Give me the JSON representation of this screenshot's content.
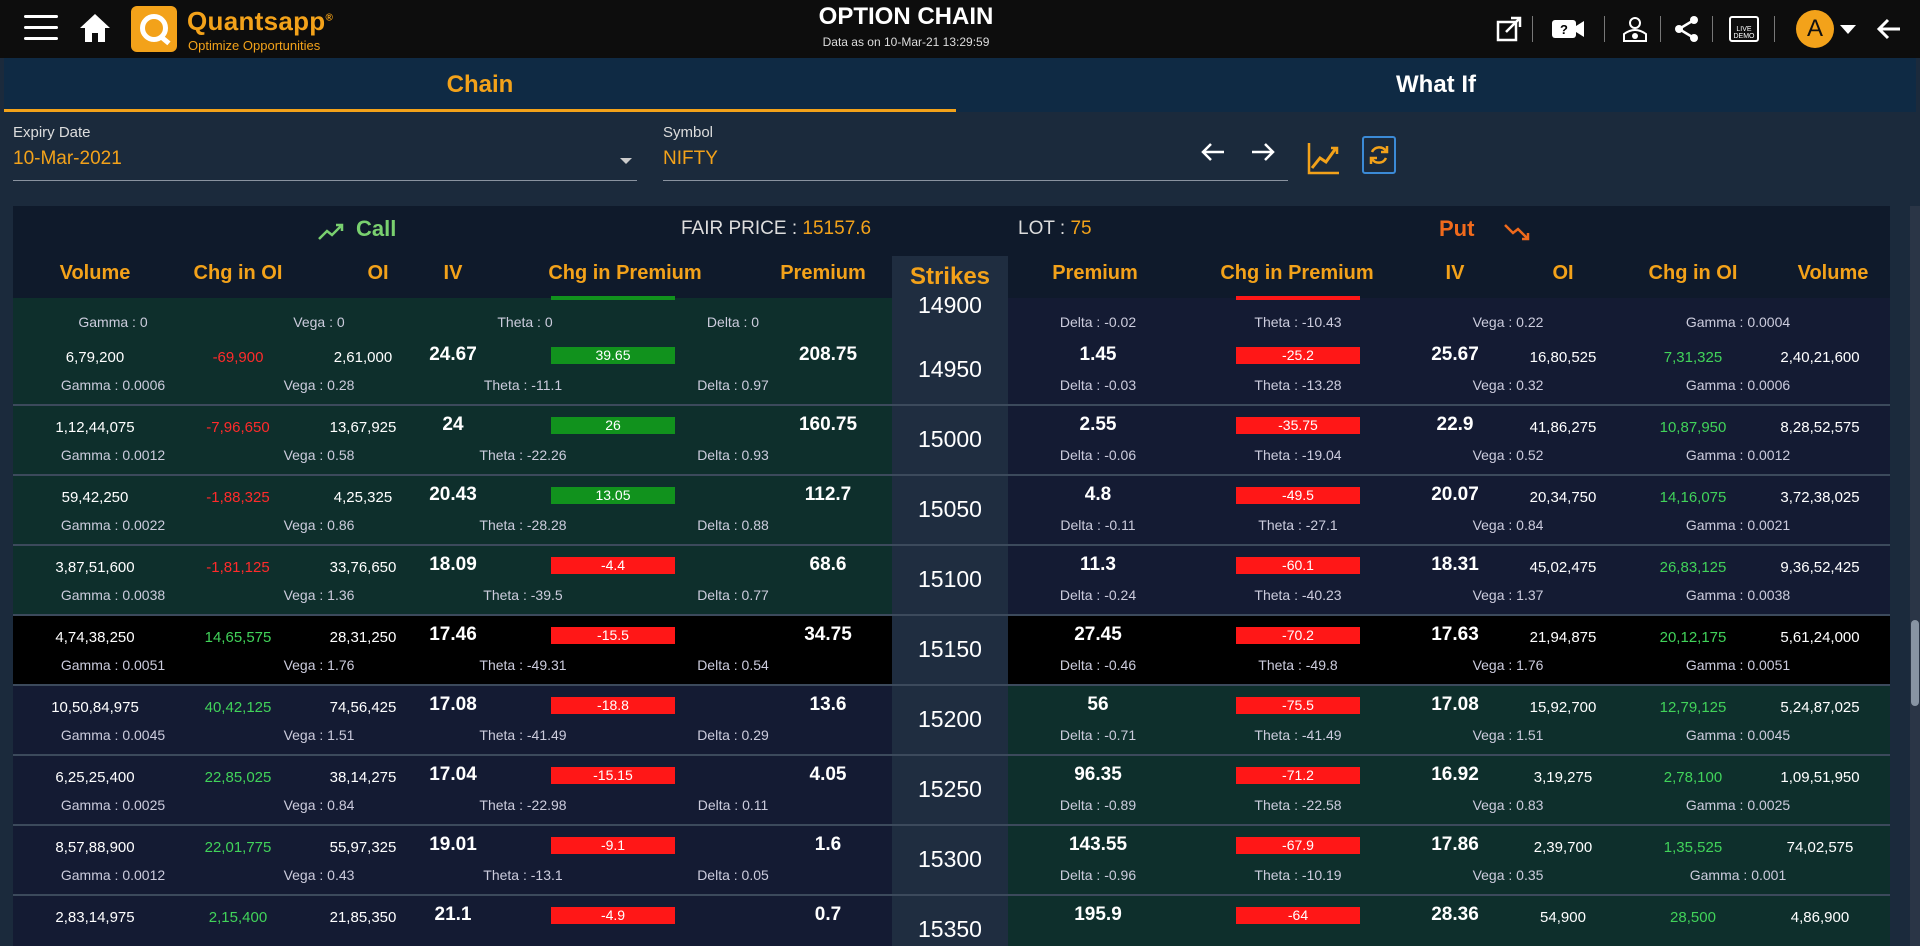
{
  "header": {
    "brand": "Quantsapp",
    "trademark": "®",
    "tagline": "Optimize Opportunities",
    "title": "OPTION CHAIN",
    "subtitle": "Data as on 10-Mar-21 13:29:59",
    "avatar_initial": "A",
    "icons": [
      "menu-icon",
      "home-icon",
      "popout-icon",
      "video-icon",
      "users-icon",
      "share-icon",
      "live-demo-icon",
      "back-arrow-icon"
    ]
  },
  "tabs": [
    {
      "label": "Chain",
      "active": true
    },
    {
      "label": "What If",
      "active": false
    }
  ],
  "filters": {
    "expiry_label": "Expiry Date",
    "expiry_value": "10-Mar-2021",
    "symbol_label": "Symbol",
    "symbol_value": "NIFTY"
  },
  "summary": {
    "call_label": "Call",
    "put_label": "Put",
    "fair_price_label": "FAIR PRICE :",
    "fair_price_value": "15157.6",
    "lot_label": "LOT :",
    "lot_value": "75"
  },
  "columns": {
    "call": [
      "Volume",
      "Chg in OI",
      "OI",
      "IV",
      "Chg in Premium",
      "Premium"
    ],
    "strikes": "Strikes",
    "put": [
      "Premium",
      "Chg in Premium",
      "IV",
      "OI",
      "Chg in OI",
      "Volume"
    ]
  },
  "partial_row": {
    "strike": "14900",
    "call_gamma": "Gamma : 0",
    "call_vega": "Vega : 0",
    "call_theta": "Theta : 0",
    "call_delta": "Delta : 0",
    "put_delta": "Delta : -0.02",
    "put_theta": "Theta : -10.43",
    "put_vega": "Vega : 0.22",
    "put_gamma": "Gamma : 0.0004"
  },
  "rows": [
    {
      "strike": "14950",
      "c_vol": "6,79,200",
      "c_chgoi": "-69,900",
      "c_oi": "2,61,000",
      "c_iv": "24.67",
      "c_chgprem": "39.65",
      "c_prem": "208.75",
      "c_gamma": "Gamma : 0.0006",
      "c_vega": "Vega : 0.28",
      "c_theta": "Theta : -11.1",
      "c_delta": "Delta : 0.97",
      "p_prem": "1.45",
      "p_chgprem": "-25.2",
      "p_iv": "25.67",
      "p_oi": "16,80,525",
      "p_chgoi": "7,31,325",
      "p_vol": "2,40,21,600",
      "p_delta": "Delta : -0.03",
      "p_theta": "Theta : -13.28",
      "p_vega": "Vega : 0.32",
      "p_gamma": "Gamma : 0.0006"
    },
    {
      "strike": "15000",
      "c_vol": "1,12,44,075",
      "c_chgoi": "-7,96,650",
      "c_oi": "13,67,925",
      "c_iv": "24",
      "c_chgprem": "26",
      "c_prem": "160.75",
      "c_gamma": "Gamma : 0.0012",
      "c_vega": "Vega : 0.58",
      "c_theta": "Theta : -22.26",
      "c_delta": "Delta : 0.93",
      "p_prem": "2.55",
      "p_chgprem": "-35.75",
      "p_iv": "22.9",
      "p_oi": "41,86,275",
      "p_chgoi": "10,87,950",
      "p_vol": "8,28,52,575",
      "p_delta": "Delta : -0.06",
      "p_theta": "Theta : -19.04",
      "p_vega": "Vega : 0.52",
      "p_gamma": "Gamma : 0.0012"
    },
    {
      "strike": "15050",
      "c_vol": "59,42,250",
      "c_chgoi": "-1,88,325",
      "c_oi": "4,25,325",
      "c_iv": "20.43",
      "c_chgprem": "13.05",
      "c_prem": "112.7",
      "c_gamma": "Gamma : 0.0022",
      "c_vega": "Vega : 0.86",
      "c_theta": "Theta : -28.28",
      "c_delta": "Delta : 0.88",
      "p_prem": "4.8",
      "p_chgprem": "-49.5",
      "p_iv": "20.07",
      "p_oi": "20,34,750",
      "p_chgoi": "14,16,075",
      "p_vol": "3,72,38,025",
      "p_delta": "Delta : -0.11",
      "p_theta": "Theta : -27.1",
      "p_vega": "Vega : 0.84",
      "p_gamma": "Gamma : 0.0021"
    },
    {
      "strike": "15100",
      "c_vol": "3,87,51,600",
      "c_chgoi": "-1,81,125",
      "c_oi": "33,76,650",
      "c_iv": "18.09",
      "c_chgprem": "-4.4",
      "c_prem": "68.6",
      "c_gamma": "Gamma : 0.0038",
      "c_vega": "Vega : 1.36",
      "c_theta": "Theta : -39.5",
      "c_delta": "Delta : 0.77",
      "p_prem": "11.3",
      "p_chgprem": "-60.1",
      "p_iv": "18.31",
      "p_oi": "45,02,475",
      "p_chgoi": "26,83,125",
      "p_vol": "9,36,52,425",
      "p_delta": "Delta : -0.24",
      "p_theta": "Theta : -40.23",
      "p_vega": "Vega : 1.37",
      "p_gamma": "Gamma : 0.0038"
    },
    {
      "strike": "15150",
      "c_vol": "4,74,38,250",
      "c_chgoi": "14,65,575",
      "c_oi": "28,31,250",
      "c_iv": "17.46",
      "c_chgprem": "-15.5",
      "c_prem": "34.75",
      "c_gamma": "Gamma : 0.0051",
      "c_vega": "Vega : 1.76",
      "c_theta": "Theta : -49.31",
      "c_delta": "Delta : 0.54",
      "p_prem": "27.45",
      "p_chgprem": "-70.2",
      "p_iv": "17.63",
      "p_oi": "21,94,875",
      "p_chgoi": "20,12,175",
      "p_vol": "5,61,24,000",
      "p_delta": "Delta : -0.46",
      "p_theta": "Theta : -49.8",
      "p_vega": "Vega : 1.76",
      "p_gamma": "Gamma : 0.0051"
    },
    {
      "strike": "15200",
      "c_vol": "10,50,84,975",
      "c_chgoi": "40,42,125",
      "c_oi": "74,56,425",
      "c_iv": "17.08",
      "c_chgprem": "-18.8",
      "c_prem": "13.6",
      "c_gamma": "Gamma : 0.0045",
      "c_vega": "Vega : 1.51",
      "c_theta": "Theta : -41.49",
      "c_delta": "Delta : 0.29",
      "p_prem": "56",
      "p_chgprem": "-75.5",
      "p_iv": "17.08",
      "p_oi": "15,92,700",
      "p_chgoi": "12,79,125",
      "p_vol": "5,24,87,025",
      "p_delta": "Delta : -0.71",
      "p_theta": "Theta : -41.49",
      "p_vega": "Vega : 1.51",
      "p_gamma": "Gamma : 0.0045"
    },
    {
      "strike": "15250",
      "c_vol": "6,25,25,400",
      "c_chgoi": "22,85,025",
      "c_oi": "38,14,275",
      "c_iv": "17.04",
      "c_chgprem": "-15.15",
      "c_prem": "4.05",
      "c_gamma": "Gamma : 0.0025",
      "c_vega": "Vega : 0.84",
      "c_theta": "Theta : -22.98",
      "c_delta": "Delta : 0.11",
      "p_prem": "96.35",
      "p_chgprem": "-71.2",
      "p_iv": "16.92",
      "p_oi": "3,19,275",
      "p_chgoi": "2,78,100",
      "p_vol": "1,09,51,950",
      "p_delta": "Delta : -0.89",
      "p_theta": "Theta : -22.58",
      "p_vega": "Vega : 0.83",
      "p_gamma": "Gamma : 0.0025"
    },
    {
      "strike": "15300",
      "c_vol": "8,57,88,900",
      "c_chgoi": "22,01,775",
      "c_oi": "55,97,325",
      "c_iv": "19.01",
      "c_chgprem": "-9.1",
      "c_prem": "1.6",
      "c_gamma": "Gamma : 0.0012",
      "c_vega": "Vega : 0.43",
      "c_theta": "Theta : -13.1",
      "c_delta": "Delta : 0.05",
      "p_prem": "143.55",
      "p_chgprem": "-67.9",
      "p_iv": "17.86",
      "p_oi": "2,39,700",
      "p_chgoi": "1,35,525",
      "p_vol": "74,02,575",
      "p_delta": "Delta : -0.96",
      "p_theta": "Theta : -10.19",
      "p_vega": "Vega : 0.35",
      "p_gamma": "Gamma : 0.001"
    },
    {
      "strike": "15350",
      "c_vol": "2,83,14,975",
      "c_chgoi": "2,15,400",
      "c_oi": "21,85,350",
      "c_iv": "21.1",
      "c_chgprem": "-4.9",
      "c_prem": "0.7",
      "c_gamma": "",
      "c_vega": "",
      "c_theta": "",
      "c_delta": "",
      "p_prem": "195.9",
      "p_chgprem": "-64",
      "p_iv": "28.36",
      "p_oi": "54,900",
      "p_chgoi": "28,500",
      "p_vol": "4,86,900",
      "p_delta": "",
      "p_theta": "",
      "p_vega": "",
      "p_gamma": ""
    }
  ],
  "colors": {
    "accent": "#f3a21a",
    "call": "#79d06f",
    "put": "#f06a1c",
    "up": "#11921d",
    "down": "#ff1717"
  }
}
